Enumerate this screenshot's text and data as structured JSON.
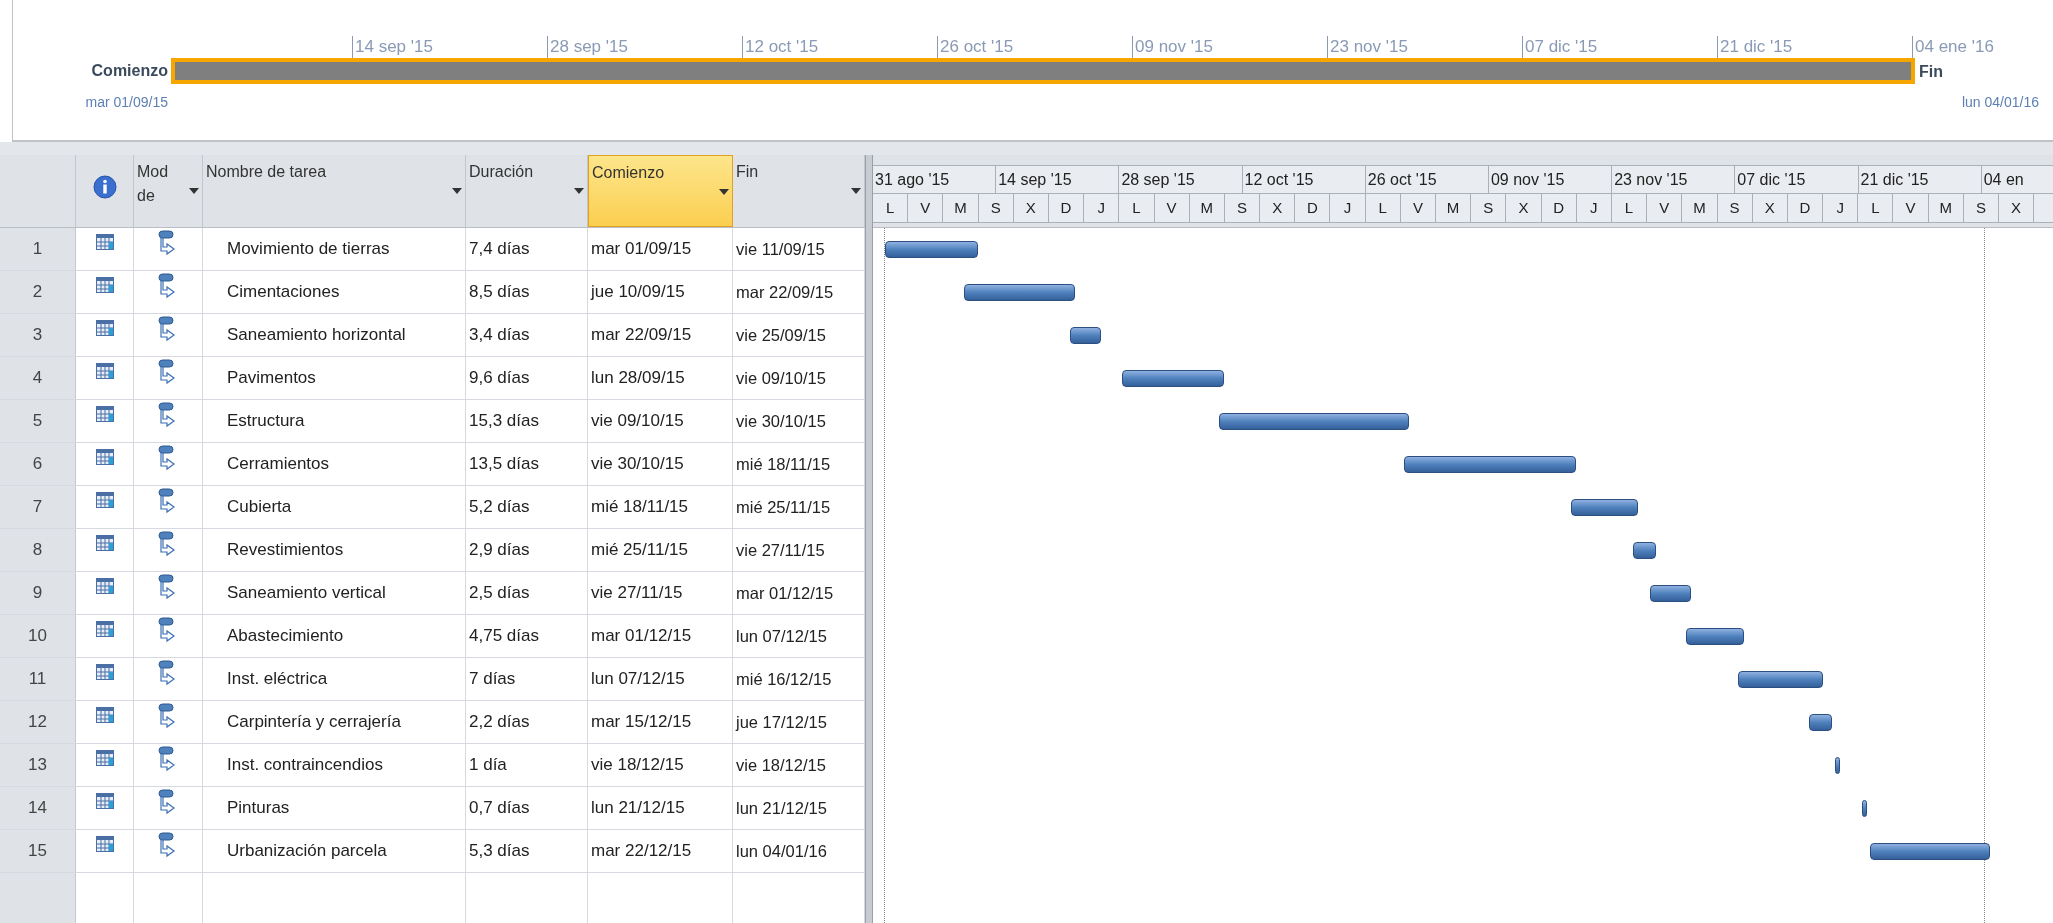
{
  "timeline": {
    "ticks": [
      "14 sep '15",
      "28 sep '15",
      "12 oct '15",
      "26 oct '15",
      "09 nov '15",
      "23 nov '15",
      "07 dic '15",
      "21 dic '15",
      "04 ene '16"
    ],
    "start_label": "Comienzo",
    "start_date": "mar 01/09/15",
    "end_label": "Fin",
    "end_date": "lun 04/01/16"
  },
  "table": {
    "columns": [
      {
        "label": "Mod de",
        "selected": false
      },
      {
        "label": "Nombre de tarea",
        "selected": false
      },
      {
        "label": "Duración",
        "selected": false
      },
      {
        "label": "Comienzo",
        "selected": true
      },
      {
        "label": "Fin",
        "selected": false
      }
    ],
    "rows": [
      {
        "id": "1",
        "name": "Movimiento de tierras",
        "duration": "7,4 días",
        "start": "mar 01/09/15",
        "finish": "vie 11/09/15"
      },
      {
        "id": "2",
        "name": "Cimentaciones",
        "duration": "8,5 días",
        "start": "jue 10/09/15",
        "finish": "mar 22/09/15"
      },
      {
        "id": "3",
        "name": "Saneamiento horizontal",
        "duration": "3,4 días",
        "start": "mar 22/09/15",
        "finish": "vie 25/09/15"
      },
      {
        "id": "4",
        "name": "Pavimentos",
        "duration": "9,6 días",
        "start": "lun 28/09/15",
        "finish": "vie 09/10/15"
      },
      {
        "id": "5",
        "name": "Estructura",
        "duration": "15,3 días",
        "start": "vie 09/10/15",
        "finish": "vie 30/10/15"
      },
      {
        "id": "6",
        "name": "Cerramientos",
        "duration": "13,5 días",
        "start": "vie 30/10/15",
        "finish": "mié 18/11/15"
      },
      {
        "id": "7",
        "name": "Cubierta",
        "duration": "5,2 días",
        "start": "mié 18/11/15",
        "finish": "mié 25/11/15"
      },
      {
        "id": "8",
        "name": "Revestimientos",
        "duration": "2,9 días",
        "start": "mié 25/11/15",
        "finish": "vie 27/11/15"
      },
      {
        "id": "9",
        "name": "Saneamiento vertical",
        "duration": "2,5 días",
        "start": "vie 27/11/15",
        "finish": "mar 01/12/15"
      },
      {
        "id": "10",
        "name": "Abastecimiento",
        "duration": "4,75 días",
        "start": "mar 01/12/15",
        "finish": "lun 07/12/15"
      },
      {
        "id": "11",
        "name": "Inst. eléctrica",
        "duration": "7 días",
        "start": "lun 07/12/15",
        "finish": "mié 16/12/15"
      },
      {
        "id": "12",
        "name": "Carpintería y cerrajería",
        "duration": "2,2 días",
        "start": "mar 15/12/15",
        "finish": "jue 17/12/15"
      },
      {
        "id": "13",
        "name": "Inst. contraincendios",
        "duration": "1 día",
        "start": "vie 18/12/15",
        "finish": "vie 18/12/15"
      },
      {
        "id": "14",
        "name": "Pinturas",
        "duration": "0,7 días",
        "start": "lun 21/12/15",
        "finish": "lun 21/12/15"
      },
      {
        "id": "15",
        "name": "Urbanización parcela",
        "duration": "5,3 días",
        "start": "mar 22/12/15",
        "finish": "lun 04/01/16"
      }
    ]
  },
  "gantt": {
    "major": [
      "31 ago '15",
      "14 sep '15",
      "28 sep '15",
      "12 oct '15",
      "26 oct '15",
      "09 nov '15",
      "23 nov '15",
      "07 dic '15",
      "21 dic '15",
      "04 en"
    ],
    "minor": [
      "L",
      "V",
      "M",
      "S",
      "X",
      "D",
      "J",
      "L",
      "V",
      "M",
      "S",
      "X",
      "D",
      "J",
      "L",
      "V",
      "M",
      "S",
      "X",
      "D",
      "J",
      "L",
      "V",
      "M",
      "S",
      "X",
      "D",
      "J",
      "L",
      "V",
      "M",
      "S",
      "X"
    ]
  }
}
